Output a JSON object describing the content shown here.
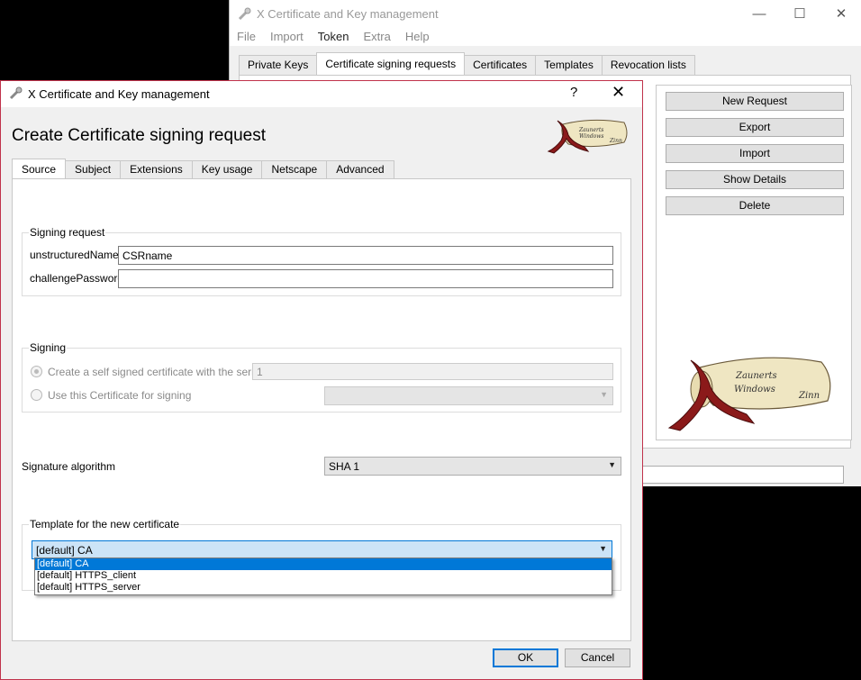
{
  "main_window": {
    "title": "X Certificate and Key management",
    "controls": {
      "minimize": "—",
      "maximize": "☐",
      "close": "✕"
    },
    "menu": [
      "File",
      "Import",
      "Token",
      "Extra",
      "Help"
    ],
    "tabs": [
      "Private Keys",
      "Certificate signing requests",
      "Certificates",
      "Templates",
      "Revocation lists"
    ],
    "buttons": [
      "New Request",
      "Export",
      "Import",
      "Show Details",
      "Delete"
    ],
    "logo_text": [
      "Zaunerts",
      "Windows",
      "Zinn"
    ]
  },
  "dialog": {
    "title": "X Certificate and Key management",
    "help": "?",
    "close": "✕",
    "heading": "Create Certificate signing request",
    "logo_text": [
      "Zaunerts",
      "Windows",
      "Zinn"
    ],
    "tabs": [
      "Source",
      "Subject",
      "Extensions",
      "Key usage",
      "Netscape",
      "Advanced"
    ],
    "signing_request": {
      "title": "Signing request",
      "unstructured_label": "unstructuredName",
      "unstructured_value": "CSRname",
      "challenge_label": "challengePassword",
      "challenge_value": ""
    },
    "signing": {
      "title": "Signing",
      "self_signed_label": "Create a self signed certificate with the serial",
      "serial_value": "1",
      "use_cert_label": "Use this Certificate for signing",
      "cert_value": ""
    },
    "signature_algorithm": {
      "label": "Signature algorithm",
      "value": "SHA 1"
    },
    "template": {
      "title": "Template for the new certificate",
      "selected": "[default] CA",
      "options": [
        "[default] CA",
        "[default] HTTPS_client",
        "[default] HTTPS_server"
      ]
    },
    "ok": "OK",
    "cancel": "Cancel"
  },
  "colors": {
    "accent": "#0078d7",
    "dialog_border": "#c0324b",
    "logo_ribbon": "#8b1a1a",
    "logo_paper": "#efe6c2"
  }
}
